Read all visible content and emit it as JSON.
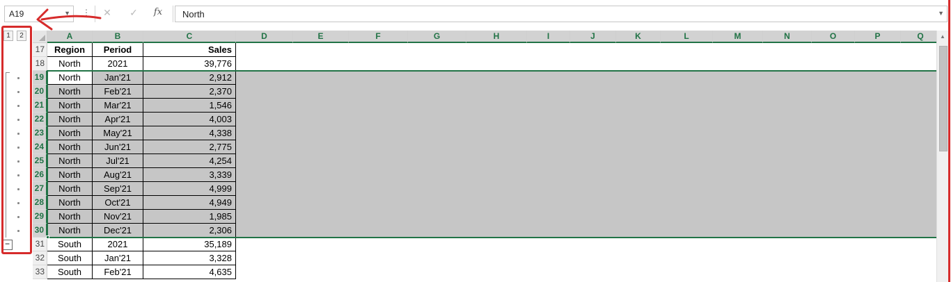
{
  "formula_bar": {
    "name_box": "A19",
    "formula_value": "North",
    "cancel_icon": "✕",
    "enter_icon": "✓",
    "fx_label": "fx"
  },
  "outline": {
    "levels": [
      "1",
      "2"
    ],
    "collapse_symbol": "−"
  },
  "columns": [
    "A",
    "B",
    "C",
    "D",
    "E",
    "F",
    "G",
    "H",
    "I",
    "J",
    "K",
    "L",
    "M",
    "N",
    "O",
    "P",
    "Q"
  ],
  "rows": [
    {
      "num": "17",
      "region": "Region",
      "period": "Period",
      "sales": "Sales"
    },
    {
      "num": "18",
      "region": "North",
      "period": "2021",
      "sales": "39,776"
    },
    {
      "num": "19",
      "region": "North",
      "period": "Jan'21",
      "sales": "2,912"
    },
    {
      "num": "20",
      "region": "North",
      "period": "Feb'21",
      "sales": "2,370"
    },
    {
      "num": "21",
      "region": "North",
      "period": "Mar'21",
      "sales": "1,546"
    },
    {
      "num": "22",
      "region": "North",
      "period": "Apr'21",
      "sales": "4,003"
    },
    {
      "num": "23",
      "region": "North",
      "period": "May'21",
      "sales": "4,338"
    },
    {
      "num": "24",
      "region": "North",
      "period": "Jun'21",
      "sales": "2,775"
    },
    {
      "num": "25",
      "region": "North",
      "period": "Jul'21",
      "sales": "4,254"
    },
    {
      "num": "26",
      "region": "North",
      "period": "Aug'21",
      "sales": "3,339"
    },
    {
      "num": "27",
      "region": "North",
      "period": "Sep'21",
      "sales": "4,999"
    },
    {
      "num": "28",
      "region": "North",
      "period": "Oct'21",
      "sales": "4,949"
    },
    {
      "num": "29",
      "region": "North",
      "period": "Nov'21",
      "sales": "1,985"
    },
    {
      "num": "30",
      "region": "North",
      "period": "Dec'21",
      "sales": "2,306"
    },
    {
      "num": "31",
      "region": "South",
      "period": "2021",
      "sales": "35,189"
    },
    {
      "num": "32",
      "region": "South",
      "period": "Jan'21",
      "sales": "3,328"
    },
    {
      "num": "33",
      "region": "South",
      "period": "Feb'21",
      "sales": "4,635"
    }
  ],
  "selection": {
    "first_row": "19",
    "last_row": "30",
    "active_cell": "A19"
  },
  "colors": {
    "excel_green": "#217346",
    "selection_fill": "#c6c6c6",
    "annotation_red": "#d62b2b"
  }
}
